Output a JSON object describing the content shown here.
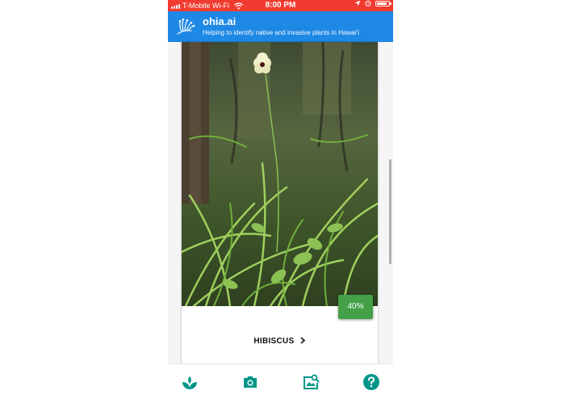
{
  "status_bar": {
    "carrier": "T-Mobile Wi-Fi",
    "time": "8:00 PM"
  },
  "app_bar": {
    "title": "ohia.ai",
    "subtitle": "Helping to identify native and invasive plants in Hawaiʻi"
  },
  "result": {
    "confidence": "40%",
    "plant_name": "HIBISCUS",
    "link_icon": "chevron-right-icon"
  },
  "bottom_nav": [
    {
      "icon": "sprout-icon"
    },
    {
      "icon": "camera-icon"
    },
    {
      "icon": "image-search-icon"
    },
    {
      "icon": "help-icon"
    }
  ],
  "colors": {
    "status_bar": "#f23b30",
    "app_bar": "#1e88e5",
    "confidence_badge": "#43a047",
    "nav_icon": "#009688"
  }
}
